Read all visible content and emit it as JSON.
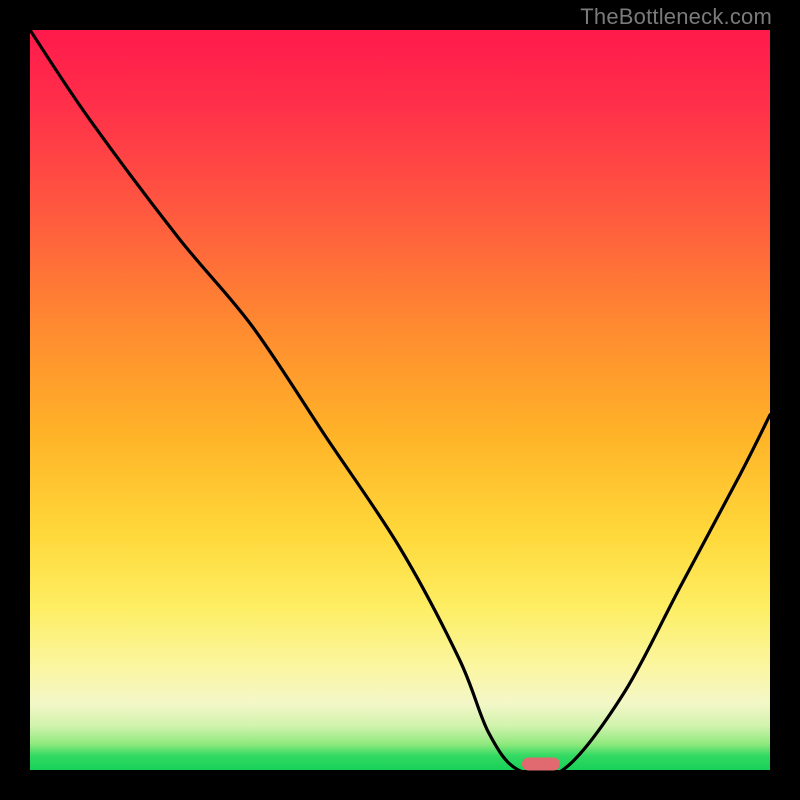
{
  "watermark": "TheBottleneck.com",
  "colors": {
    "frame": "#000000",
    "gradient_top": "#ff1a4b",
    "gradient_mid": "#ffd83a",
    "gradient_bottom": "#16d158",
    "curve": "#000000",
    "marker": "#e06a6f"
  },
  "chart_data": {
    "type": "line",
    "title": "",
    "xlabel": "",
    "ylabel": "",
    "xlim": [
      0,
      100
    ],
    "ylim": [
      0,
      100
    ],
    "grid": false,
    "series": [
      {
        "name": "curve",
        "x": [
          0,
          8,
          20,
          30,
          40,
          50,
          58,
          62,
          66,
          72,
          80,
          88,
          96,
          100
        ],
        "values": [
          100,
          88,
          72,
          60,
          45,
          30,
          15,
          5,
          0,
          0,
          10,
          25,
          40,
          48
        ]
      }
    ],
    "marker": {
      "x": 69,
      "y": 0
    },
    "annotations": []
  }
}
